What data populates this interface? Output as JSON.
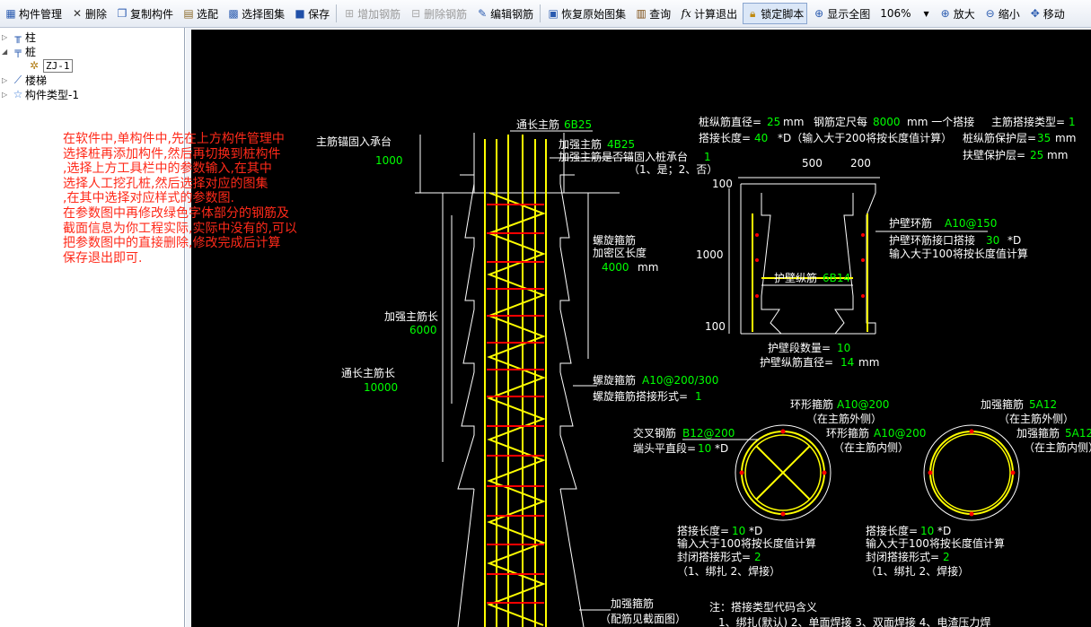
{
  "toolbar": {
    "component_manager": "构件管理",
    "delete": "删除",
    "copy_component": "复制构件",
    "pick_config": "选配",
    "choose_atlas": "选择图集",
    "save": "保存",
    "add_rebar": "增加钢筋",
    "delete_rebar": "删除钢筋",
    "edit_rebar": "编辑钢筋",
    "restore_atlas": "恢复原始图集",
    "query": "查询",
    "calc_exit": "计算退出",
    "lock_script": "锁定脚本",
    "show_all": "显示全图",
    "zoom_level": "106%",
    "zoom_in": "放大",
    "zoom_out": "缩小",
    "move": "移动"
  },
  "tree": {
    "column": "柱",
    "pile": "桩",
    "pile_child": "ZJ-1",
    "stairs": "楼梯",
    "component_type": "构件类型-1"
  },
  "annotation": [
    "在软件中,单构件中,先在上方构件管理中",
    "选择桩再添加构件,然后再切换到桩构件",
    ",选择上方工具栏中的参数输入,在其中",
    "选择人工挖孔桩,然后选择对应的图集",
    ",在其中选择对应样式的参数图.",
    "在参数图中再修改绿色字体部分的钢筋及",
    "截面信息为你工程实际,实际中没有的,可以",
    "把参数图中的直接删除,修改完成后计算",
    "保存退出即可."
  ],
  "cad": {
    "through_main_label": "通长主筋",
    "through_main_value": "6B25",
    "anchor_label": "主筋锚固入承台",
    "anchor_value": "1000",
    "strengthen_main_label": "加强主筋",
    "strengthen_main_value": "4B25",
    "anchor_into_cap_label": "加强主筋是否锚固入桩承台",
    "anchor_into_cap_value": "1",
    "anchor_into_cap_hint": "（1、是；2、否）",
    "spiral_label1": "螺旋箍筋",
    "spiral_label2": "加密区长度",
    "spiral_len": "4000",
    "unit_mm": "mm",
    "strengthen_len_label": "加强主筋长",
    "strengthen_len": "6000",
    "through_len_label": "通长主筋长",
    "through_len": "10000",
    "spiral_stirrup_label": "螺旋箍筋",
    "spiral_stirrup_value": "A10@200/300",
    "spiral_lap_label": "螺旋箍筋搭接形式=",
    "spiral_lap_value": "1",
    "strengthen_stirrup_label": "加强箍筋",
    "strengthen_stirrup_note": "（配筋见截面图）",
    "pile_rebar_dia_label": "桩纵筋直径=",
    "pile_rebar_dia": "25",
    "rebar_len_label": "钢筋定尺每",
    "rebar_len": "8000",
    "rebar_len_suffix": "mm 一个搭接",
    "lap_type_label": "主筋搭接类型=",
    "lap_type": "1",
    "lap_len_label": "搭接长度=",
    "lap_len": "40",
    "lap_len_suffix": "*D（输入大于200将按长度值计算）",
    "cover_label": "桩纵筋保护层=",
    "cover": "35",
    "wall_cover_label": "扶壁保护层=",
    "wall_cover": "25",
    "dim_500": "500",
    "dim_200": "200",
    "dim_100_top": "100",
    "dim_1000": "1000",
    "dim_100_bottom": "100",
    "wall_ring_label": "护壁环筋",
    "wall_ring_value": "A10@150",
    "wall_ring_lap_label": "护壁环筋接口搭接",
    "wall_ring_lap_value": "30",
    "wall_ring_lap_unit": "*D",
    "wall_ring_hint": "输入大于100将按长度值计算",
    "wall_long_label": "护壁纵筋",
    "wall_long_value": "6B14",
    "wall_seg_count_label": "护壁段数量=",
    "wall_seg_count": "10",
    "wall_long_dia_label": "护壁纵筋直径=",
    "wall_long_dia": "14",
    "ring_stirrup_label": "环形箍筋",
    "ring_stirrup_value": "A10@200",
    "outside_main": "（在主筋外侧）",
    "cross_rebar_label": "交叉钢筋",
    "cross_rebar_value": "B12@200",
    "end_straight_label": "端头平直段=",
    "end_straight_value": "10",
    "end_straight_unit": "*D",
    "ring_stirrup2_label": "环形箍筋",
    "ring_stirrup2_value": "A10@200",
    "inside_main": "（在主筋内侧）",
    "strengthen_stirrup2_label": "加强箍筋",
    "strengthen_stirrup2_value": "5A12",
    "strengthen_stirrup3_label": "加强箍筋",
    "strengthen_stirrup3_value": "5A12",
    "lap_len2_label": "搭接长度=",
    "lap_len2_value": "10",
    "lap_len2_unit": "*D",
    "lap_hint": "输入大于100将按长度值计算",
    "closed_lap_label": "封闭搭接形式=",
    "closed_lap_value": "2",
    "closed_lap_hint": "（1、绑扎 2、焊接）",
    "lap_len3_value": "10",
    "closed_lap3_value": "2",
    "note_title": "注：搭接类型代码含义",
    "note_items": "1、绑扎(默认)  2、单面焊接  3、双面焊接  4、电渣压力焊"
  },
  "colors": {
    "canvas_bg": "#000000",
    "param_green": "#00ff00",
    "rebar_yellow": "#ffff00",
    "stirrup_red": "#ff0000",
    "annotation_red": "#ff2a1a"
  }
}
